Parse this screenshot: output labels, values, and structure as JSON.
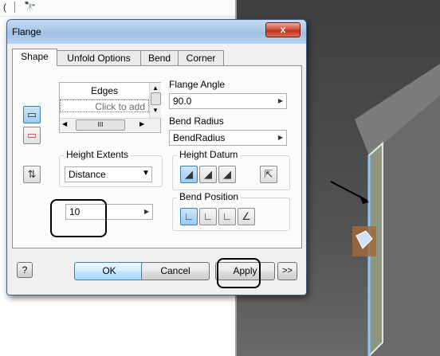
{
  "app": {
    "top_text": "(",
    "top_icon": "find-icon"
  },
  "dialog": {
    "title": "Flange",
    "close_label": "x",
    "tabs": [
      {
        "label": "Shape",
        "active": true
      },
      {
        "label": "Unfold Options",
        "active": false
      },
      {
        "label": "Bend",
        "active": false
      },
      {
        "label": "Corner",
        "active": false
      }
    ],
    "edges": {
      "header": "Edges",
      "placeholder": "Click to add",
      "hscroll_grip": "III"
    },
    "flange_angle": {
      "label": "Flange Angle",
      "value": "90.0"
    },
    "bend_radius": {
      "label": "Bend Radius",
      "value": "BendRadius"
    },
    "height_extents": {
      "label": "Height Extents",
      "value": "Distance"
    },
    "distance_value": "10",
    "height_datum": {
      "label": "Height Datum"
    },
    "bend_position": {
      "label": "Bend Position"
    },
    "buttons": {
      "help": "?",
      "ok": "OK",
      "cancel": "Cancel",
      "apply": "Apply",
      "more": ">>"
    }
  },
  "colors": {
    "accent": "#3c7fb1",
    "viewport": "#4a4a4a",
    "edge_highlight": "#8ec6ff"
  }
}
